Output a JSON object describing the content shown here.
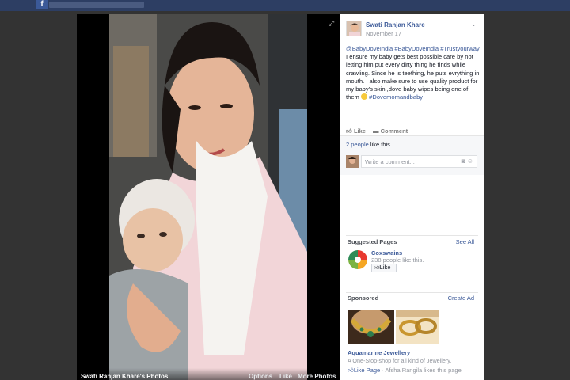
{
  "photo": {
    "owner_label": "Swati Ranjan Khare's Photos",
    "options": [
      "Options",
      "Like",
      "More Photos"
    ]
  },
  "post": {
    "author": "Swati Ranjan Khare",
    "date": "November 17",
    "text": {
      "tag1": "@BabyDoveIndia",
      "tag2": "#BabyDoveIndia",
      "tag3": "#Trustyourway",
      "body": " I ensure my baby gets best possible care by not letting him put every dirty thing he finds while crawling. Since he is teething, he puts evrything in mouth. I also make sure to use quality product for my baby's skin ,dove baby wipes being one of them ",
      "tag4": "#Dovemomandbaby"
    },
    "actions": {
      "like": "Like",
      "comment": "Comment"
    },
    "likes": {
      "count_link": "2 people",
      "suffix": " like this."
    },
    "comment_placeholder": "Write a comment..."
  },
  "suggested": {
    "title": "Suggested Pages",
    "see_all": "See All",
    "page_name": "Coxswains",
    "page_sub": "238 people like this.",
    "like_button": "Like"
  },
  "sponsored": {
    "title": "Sponsored",
    "create_ad": "Create Ad",
    "ad_title": "Aquamarine Jewellery",
    "ad_desc": "A One-Stop-shop for all kind of Jewellery.",
    "like_page": "Like Page",
    "liker": " · Afsha Rangila likes this page"
  },
  "colors": {
    "link": "#3b5998",
    "topbar": "#2d3e63",
    "overlay": "#333333"
  },
  "icons": {
    "expand": "expand-icon",
    "chevron": "chevron-down-icon",
    "like": "thumbs-up-icon",
    "comment": "comment-icon",
    "camera": "camera-icon",
    "emoji": "emoji-icon"
  }
}
